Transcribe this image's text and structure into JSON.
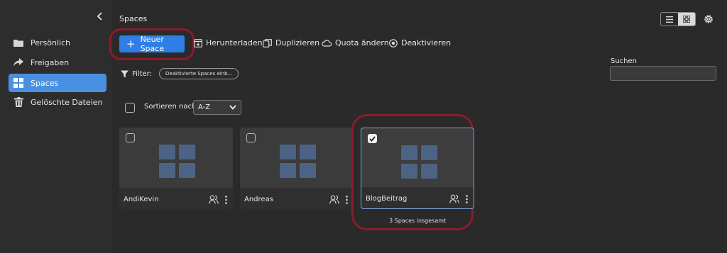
{
  "sidebar": {
    "items": [
      {
        "label": "Persönlich",
        "icon": "folder-icon",
        "active": false
      },
      {
        "label": "Freigaben",
        "icon": "share-arrow-icon",
        "active": false
      },
      {
        "label": "Spaces",
        "icon": "grid-icon",
        "active": true
      },
      {
        "label": "Gelöschte Dateien",
        "icon": "trash-icon",
        "active": false
      }
    ]
  },
  "header": {
    "title": "Spaces"
  },
  "toolbar": {
    "new_space": "Neuer Space",
    "download": "Herunterladen",
    "duplicate": "Duplizieren",
    "quota": "Quota ändern",
    "deactivate": "Deaktivieren"
  },
  "filter": {
    "label": "Filter:",
    "chip": "Deaktivierte Spaces einb..."
  },
  "search": {
    "label": "Suchen",
    "value": ""
  },
  "sort": {
    "label": "Sortieren nach",
    "value": "A-Z"
  },
  "cards": [
    {
      "name": "AndiKevin",
      "checked": false
    },
    {
      "name": "Andreas",
      "checked": false
    },
    {
      "name": "BlogBeitrag",
      "checked": true
    }
  ],
  "footer": {
    "total": "3 Spaces insgesamt"
  },
  "colors": {
    "accent": "#2f7ee6",
    "highlight": "#8b1c2c",
    "tile": "#4c6385"
  }
}
